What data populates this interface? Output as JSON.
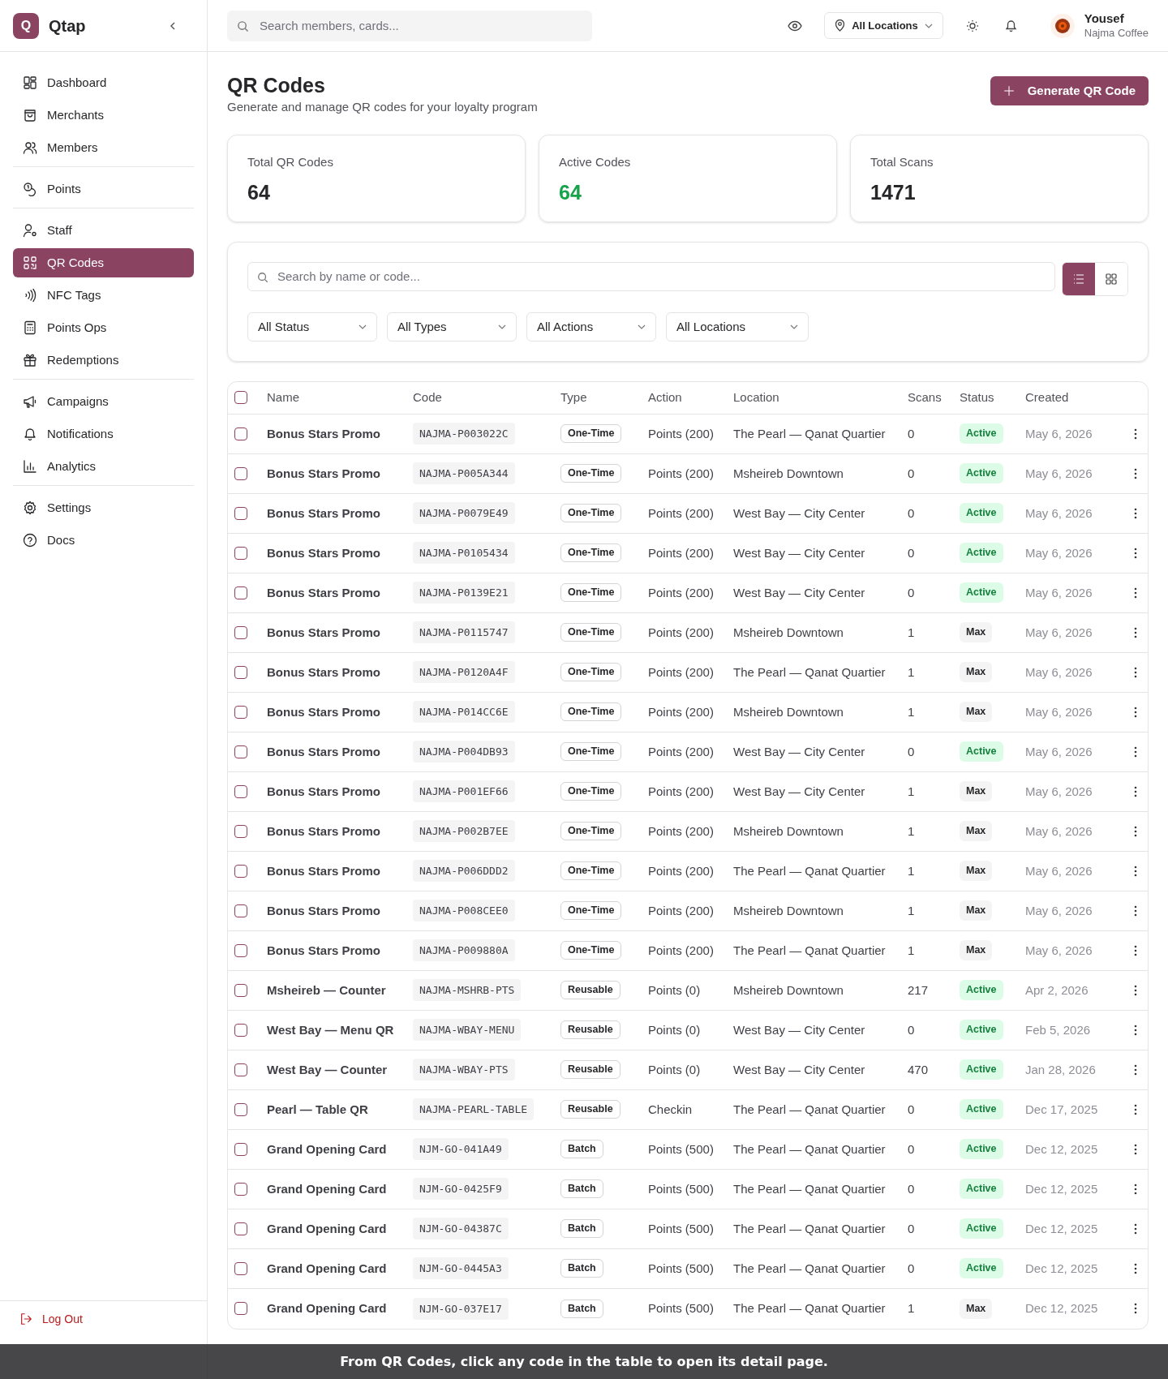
{
  "brand": {
    "logo_letter": "Q",
    "name": "Qtap"
  },
  "sidebar": {
    "groups": [
      {
        "items": [
          {
            "label": "Dashboard",
            "selected": false
          },
          {
            "label": "Merchants",
            "selected": false
          },
          {
            "label": "Members",
            "selected": false
          }
        ]
      },
      {
        "items": [
          {
            "label": "Points",
            "selected": false
          }
        ]
      },
      {
        "items": [
          {
            "label": "Staff",
            "selected": false
          },
          {
            "label": "QR Codes",
            "selected": true
          },
          {
            "label": "NFC Tags",
            "selected": false
          },
          {
            "label": "Points Ops",
            "selected": false
          },
          {
            "label": "Redemptions",
            "selected": false
          }
        ]
      },
      {
        "items": [
          {
            "label": "Campaigns",
            "selected": false
          },
          {
            "label": "Notifications",
            "selected": false
          },
          {
            "label": "Analytics",
            "selected": false
          }
        ]
      },
      {
        "items": [
          {
            "label": "Settings",
            "selected": false
          },
          {
            "label": "Docs",
            "selected": false
          }
        ]
      }
    ],
    "logout": "Log Out"
  },
  "topbar": {
    "search_placeholder": "Search members, cards...",
    "location": "All Locations",
    "user": {
      "name": "Yousef",
      "org": "Najma Coffee"
    }
  },
  "page": {
    "title": "QR Codes",
    "subtitle": "Generate and manage QR codes for your loyalty program",
    "primary_button": "Generate QR Code"
  },
  "stats": [
    {
      "label": "Total QR Codes",
      "value": "64",
      "kind": "plain"
    },
    {
      "label": "Active Codes",
      "value": "64",
      "kind": "positive"
    },
    {
      "label": "Total Scans",
      "value": "1471",
      "kind": "plain"
    }
  ],
  "filters": {
    "search_placeholder": "Search by name or code...",
    "view_modes": [
      {
        "kind": "list",
        "selected": true
      },
      {
        "kind": "grid",
        "selected": false
      }
    ],
    "dropdowns": [
      "All Status",
      "All Types",
      "All Actions",
      "All Locations"
    ]
  },
  "table": {
    "select_all_checked": false,
    "columns": [
      "Name",
      "Code",
      "Type",
      "Action",
      "Location",
      "Scans",
      "Status",
      "Created"
    ],
    "rows": [
      {
        "checked": false,
        "name": "Bonus Stars Promo",
        "code": "NAJMA-P003022C",
        "type": "One-Time",
        "action": "Points (200)",
        "location": "The Pearl — Qanat Quartier",
        "scans": "0",
        "status": "Active",
        "created": "May 6, 2026"
      },
      {
        "checked": false,
        "name": "Bonus Stars Promo",
        "code": "NAJMA-P005A344",
        "type": "One-Time",
        "action": "Points (200)",
        "location": "Msheireb Downtown",
        "scans": "0",
        "status": "Active",
        "created": "May 6, 2026"
      },
      {
        "checked": false,
        "name": "Bonus Stars Promo",
        "code": "NAJMA-P0079E49",
        "type": "One-Time",
        "action": "Points (200)",
        "location": "West Bay — City Center",
        "scans": "0",
        "status": "Active",
        "created": "May 6, 2026"
      },
      {
        "checked": false,
        "name": "Bonus Stars Promo",
        "code": "NAJMA-P0105434",
        "type": "One-Time",
        "action": "Points (200)",
        "location": "West Bay — City Center",
        "scans": "0",
        "status": "Active",
        "created": "May 6, 2026"
      },
      {
        "checked": false,
        "name": "Bonus Stars Promo",
        "code": "NAJMA-P0139E21",
        "type": "One-Time",
        "action": "Points (200)",
        "location": "West Bay — City Center",
        "scans": "0",
        "status": "Active",
        "created": "May 6, 2026"
      },
      {
        "checked": false,
        "name": "Bonus Stars Promo",
        "code": "NAJMA-P0115747",
        "type": "One-Time",
        "action": "Points (200)",
        "location": "Msheireb Downtown",
        "scans": "1",
        "status": "Max",
        "created": "May 6, 2026"
      },
      {
        "checked": false,
        "name": "Bonus Stars Promo",
        "code": "NAJMA-P0120A4F",
        "type": "One-Time",
        "action": "Points (200)",
        "location": "The Pearl — Qanat Quartier",
        "scans": "1",
        "status": "Max",
        "created": "May 6, 2026"
      },
      {
        "checked": false,
        "name": "Bonus Stars Promo",
        "code": "NAJMA-P014CC6E",
        "type": "One-Time",
        "action": "Points (200)",
        "location": "Msheireb Downtown",
        "scans": "1",
        "status": "Max",
        "created": "May 6, 2026"
      },
      {
        "checked": false,
        "name": "Bonus Stars Promo",
        "code": "NAJMA-P004DB93",
        "type": "One-Time",
        "action": "Points (200)",
        "location": "West Bay — City Center",
        "scans": "0",
        "status": "Active",
        "created": "May 6, 2026"
      },
      {
        "checked": false,
        "name": "Bonus Stars Promo",
        "code": "NAJMA-P001EF66",
        "type": "One-Time",
        "action": "Points (200)",
        "location": "West Bay — City Center",
        "scans": "1",
        "status": "Max",
        "created": "May 6, 2026"
      },
      {
        "checked": false,
        "name": "Bonus Stars Promo",
        "code": "NAJMA-P002B7EE",
        "type": "One-Time",
        "action": "Points (200)",
        "location": "Msheireb Downtown",
        "scans": "1",
        "status": "Max",
        "created": "May 6, 2026"
      },
      {
        "checked": false,
        "name": "Bonus Stars Promo",
        "code": "NAJMA-P006DDD2",
        "type": "One-Time",
        "action": "Points (200)",
        "location": "The Pearl — Qanat Quartier",
        "scans": "1",
        "status": "Max",
        "created": "May 6, 2026"
      },
      {
        "checked": false,
        "name": "Bonus Stars Promo",
        "code": "NAJMA-P008CEE0",
        "type": "One-Time",
        "action": "Points (200)",
        "location": "Msheireb Downtown",
        "scans": "1",
        "status": "Max",
        "created": "May 6, 2026"
      },
      {
        "checked": false,
        "name": "Bonus Stars Promo",
        "code": "NAJMA-P009880A",
        "type": "One-Time",
        "action": "Points (200)",
        "location": "The Pearl — Qanat Quartier",
        "scans": "1",
        "status": "Max",
        "created": "May 6, 2026"
      },
      {
        "checked": false,
        "name": "Msheireb — Counter",
        "code": "NAJMA-MSHRB-PTS",
        "type": "Reusable",
        "action": "Points (0)",
        "location": "Msheireb Downtown",
        "scans": "217",
        "status": "Active",
        "created": "Apr 2, 2026"
      },
      {
        "checked": false,
        "name": "West Bay — Menu QR",
        "code": "NAJMA-WBAY-MENU",
        "type": "Reusable",
        "action": "Points (0)",
        "location": "West Bay — City Center",
        "scans": "0",
        "status": "Active",
        "created": "Feb 5, 2026"
      },
      {
        "checked": false,
        "name": "West Bay — Counter",
        "code": "NAJMA-WBAY-PTS",
        "type": "Reusable",
        "action": "Points (0)",
        "location": "West Bay — City Center",
        "scans": "470",
        "status": "Active",
        "created": "Jan 28, 2026"
      },
      {
        "checked": false,
        "name": "Pearl — Table QR",
        "code": "NAJMA-PEARL-TABLE",
        "type": "Reusable",
        "action": "Checkin",
        "location": "The Pearl — Qanat Quartier",
        "scans": "0",
        "status": "Active",
        "created": "Dec 17, 2025"
      },
      {
        "checked": false,
        "name": "Grand Opening Card",
        "code": "NJM-GO-041A49",
        "type": "Batch",
        "action": "Points (500)",
        "location": "The Pearl — Qanat Quartier",
        "scans": "0",
        "status": "Active",
        "created": "Dec 12, 2025"
      },
      {
        "checked": false,
        "name": "Grand Opening Card",
        "code": "NJM-GO-0425F9",
        "type": "Batch",
        "action": "Points (500)",
        "location": "The Pearl — Qanat Quartier",
        "scans": "0",
        "status": "Active",
        "created": "Dec 12, 2025"
      },
      {
        "checked": false,
        "name": "Grand Opening Card",
        "code": "NJM-GO-04387C",
        "type": "Batch",
        "action": "Points (500)",
        "location": "The Pearl — Qanat Quartier",
        "scans": "0",
        "status": "Active",
        "created": "Dec 12, 2025"
      },
      {
        "checked": false,
        "name": "Grand Opening Card",
        "code": "NJM-GO-0445A3",
        "type": "Batch",
        "action": "Points (500)",
        "location": "The Pearl — Qanat Quartier",
        "scans": "0",
        "status": "Active",
        "created": "Dec 12, 2025"
      },
      {
        "checked": false,
        "name": "Grand Opening Card",
        "code": "NJM-GO-037E17",
        "type": "Batch",
        "action": "Points (500)",
        "location": "The Pearl — Qanat Quartier",
        "scans": "1",
        "status": "Max",
        "created": "Dec 12, 2025"
      }
    ]
  },
  "caption": "From QR Codes, click any code in the table to open its detail page."
}
